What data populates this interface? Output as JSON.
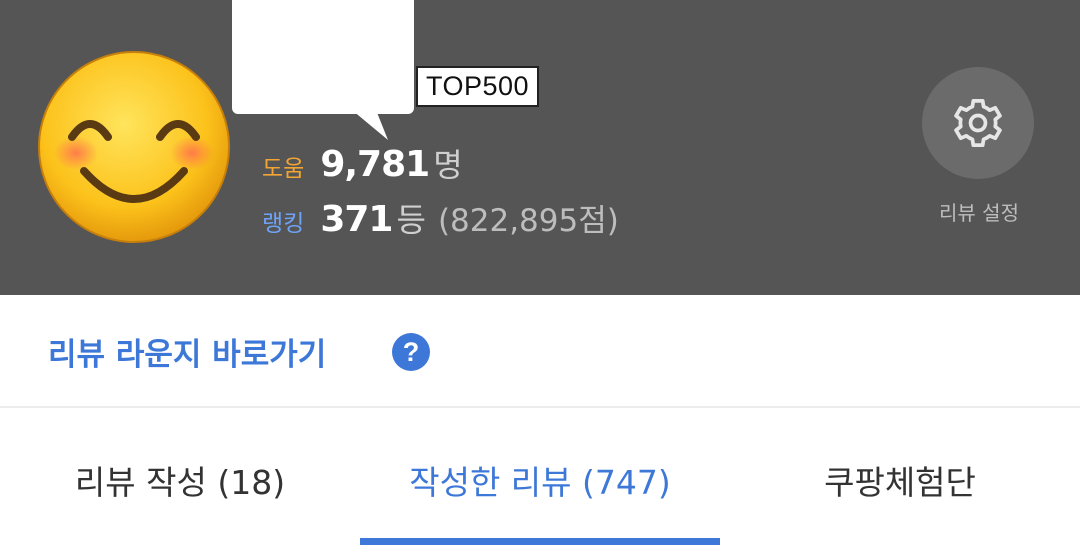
{
  "header": {
    "badge": "TOP500",
    "help_label": "도움",
    "help_value": "9,781",
    "help_unit": "명",
    "rank_label": "랭킹",
    "rank_value": "371",
    "rank_unit": "등",
    "rank_score": "(822,895점)",
    "settings_label": "리뷰 설정",
    "avatar_icon": "smiling-face-emoji",
    "settings_icon": "gear-icon"
  },
  "lounge": {
    "label": "리뷰 라운지 바로가기",
    "help_glyph": "?"
  },
  "tabs": [
    {
      "label": "리뷰 작성 (18)",
      "active": false
    },
    {
      "label": "작성한 리뷰 (747)",
      "active": true
    },
    {
      "label": "쿠팡체험단",
      "active": false
    }
  ],
  "colors": {
    "header_bg": "#555555",
    "accent_blue": "#3d78d8",
    "help_label": "#f2a534",
    "rank_label": "#6fa3f7"
  }
}
